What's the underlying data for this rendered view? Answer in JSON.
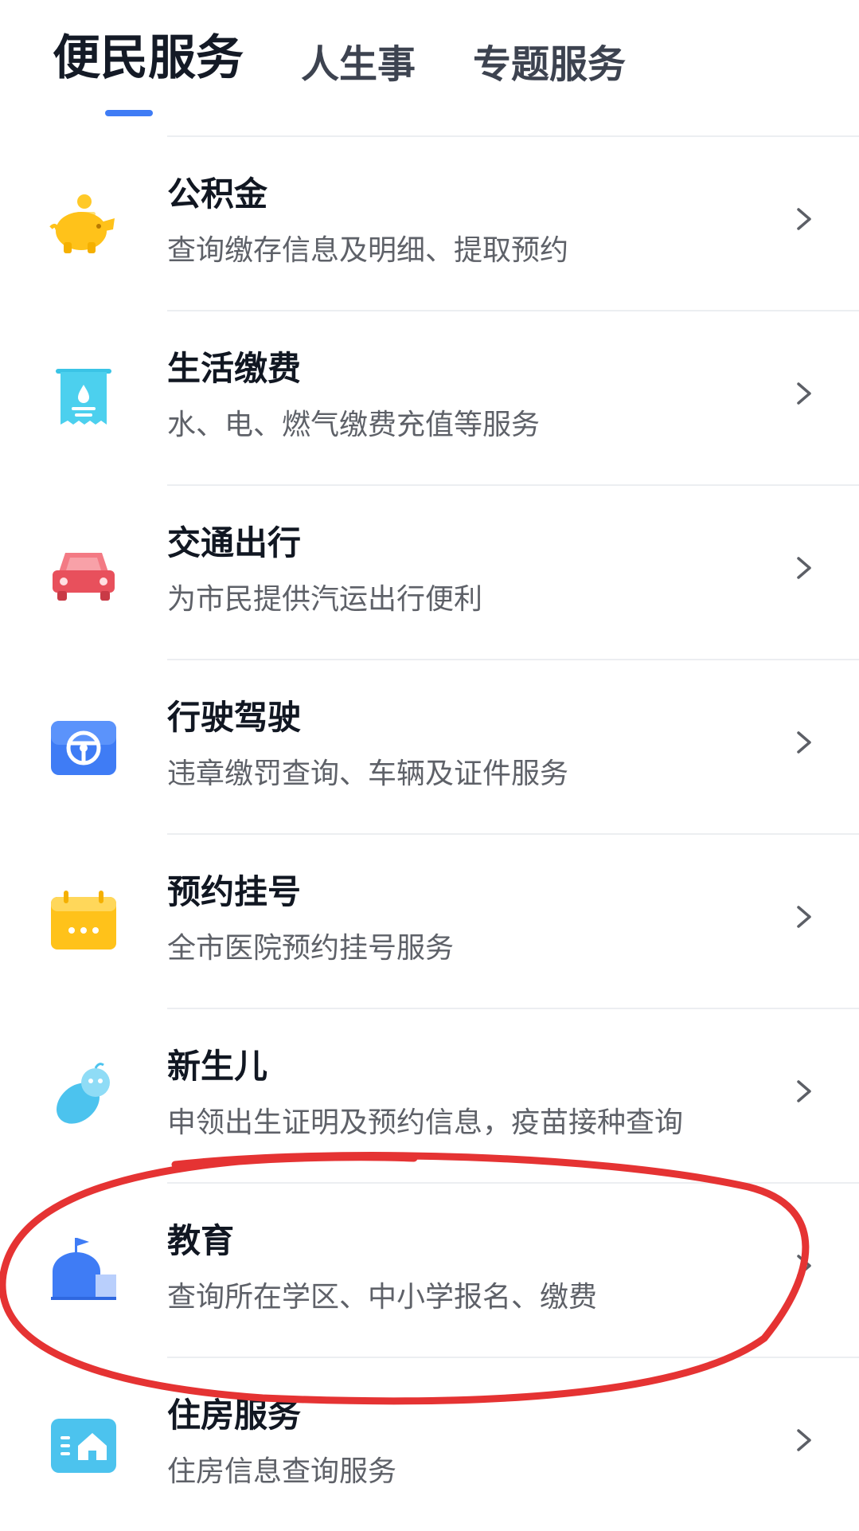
{
  "tabs": [
    {
      "label": "便民服务",
      "active": true
    },
    {
      "label": "人生事",
      "active": false
    },
    {
      "label": "专题服务",
      "active": false
    }
  ],
  "colors": {
    "accent": "#3f7cf5",
    "annotation": "#e53333"
  },
  "services": [
    {
      "title": "公积金",
      "desc": "查询缴存信息及明细、提取预约",
      "icon": "piggy-bank-icon"
    },
    {
      "title": "生活缴费",
      "desc": "水、电、燃气缴费充值等服务",
      "icon": "bill-water-drop-icon"
    },
    {
      "title": "交通出行",
      "desc": "为市民提供汽运出行便利",
      "icon": "car-icon"
    },
    {
      "title": "行驶驾驶",
      "desc": "违章缴罚查询、车辆及证件服务",
      "icon": "steering-wheel-icon"
    },
    {
      "title": "预约挂号",
      "desc": "全市医院预约挂号服务",
      "icon": "calendar-icon"
    },
    {
      "title": "新生儿",
      "desc": "申领出生证明及预约信息，疫苗接种查询",
      "icon": "baby-icon"
    },
    {
      "title": "教育",
      "desc": "查询所在学区、中小学报名、缴费",
      "icon": "school-icon",
      "highlighted": true
    },
    {
      "title": "住房服务",
      "desc": "住房信息查询服务",
      "icon": "house-icon"
    }
  ]
}
